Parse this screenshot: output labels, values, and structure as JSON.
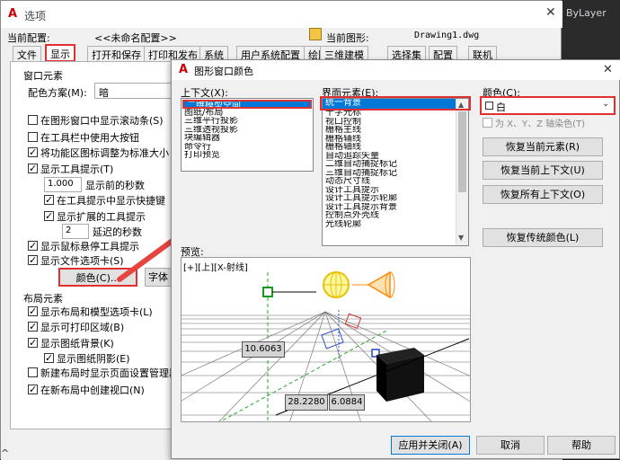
{
  "back_dialog": {
    "title": "选项",
    "current_profile_label": "当前配置:",
    "current_profile_value": "<<未命名配置>>",
    "current_drawing_label": "当前图形:",
    "current_drawing_value": "Drawing1.dwg",
    "tabs": [
      "文件",
      "显示",
      "打开和保存",
      "打印和发布",
      "系统",
      "用户系统配置",
      "绘图",
      "三维建模",
      "选择集",
      "配置",
      "联机"
    ],
    "window_elements": {
      "heading": "窗口元素",
      "color_scheme_label": "配色方案(M):",
      "color_scheme_value": "暗",
      "items": [
        {
          "label": "在图形窗口中显示滚动条(S)",
          "checked": false
        },
        {
          "label": "在工具栏中使用大按钮",
          "checked": false
        },
        {
          "label": "将功能区图标调整为标准大小",
          "checked": true
        },
        {
          "label": "显示工具提示(T)",
          "checked": true
        }
      ],
      "delay_value": "1.000",
      "delay_label": "显示前的秒数",
      "shortcut_label": "在工具提示中显示快捷键",
      "extended_label": "显示扩展的工具提示",
      "ext_delay_value": "2",
      "ext_delay_label": "延迟的秒数",
      "rollover_label": "显示鼠标悬停工具提示",
      "file_tabs_label": "显示文件选项卡(S)",
      "colors_button": "颜色(C)...",
      "fonts_button": "字体"
    },
    "layout_elements": {
      "heading": "布局元素",
      "items": [
        {
          "label": "显示布局和模型选项卡(L)",
          "checked": true
        },
        {
          "label": "显示可打印区域(B)",
          "checked": true
        },
        {
          "label": "显示图纸背景(K)",
          "checked": true
        },
        {
          "label": "显示图纸阴影(E)",
          "checked": true
        },
        {
          "label": "新建布局时显示页面设置管理器",
          "checked": false
        },
        {
          "label": "在新布局中创建视口(N)",
          "checked": true
        }
      ]
    },
    "bylayer": "ByLayer"
  },
  "front_dialog": {
    "title": "图形窗口颜色",
    "context_label": "上下文(X):",
    "contexts": [
      "二维模型空间",
      "图纸/布局",
      "三维平行投影",
      "三维透视投影",
      "块编辑器",
      "命令行",
      "打印预览"
    ],
    "interface_label": "界面元素(E):",
    "interface_items": [
      "统一背景",
      "十字光标",
      "视口控制",
      "栅格主线",
      "栅格辅线",
      "栅格轴线",
      "自动追踪矢量",
      "二维自动捕捉标记",
      "三维自动捕捉标记",
      "动态尺寸线",
      "设计工具提示",
      "设计工具提示轮廓",
      "设计工具提示背景",
      "控制点外壳线",
      "光线轮廓"
    ],
    "color_label": "颜色(C):",
    "color_value": "白",
    "tint_label": "为 X、Y、Z 轴染色(T)",
    "buttons": [
      "恢复当前元素(R)",
      "恢复当前上下文(U)",
      "恢复所有上下文(O)",
      "恢复传统颜色(L)"
    ],
    "preview_label": "预览:",
    "viewport_label": "[+][上][X-射线]",
    "dim1": "10.6063",
    "dim2": "28.2280",
    "dim3": "6.0884",
    "apply_button": "应用并关闭(A)",
    "cancel_button": "取消",
    "help_button": "帮助"
  }
}
